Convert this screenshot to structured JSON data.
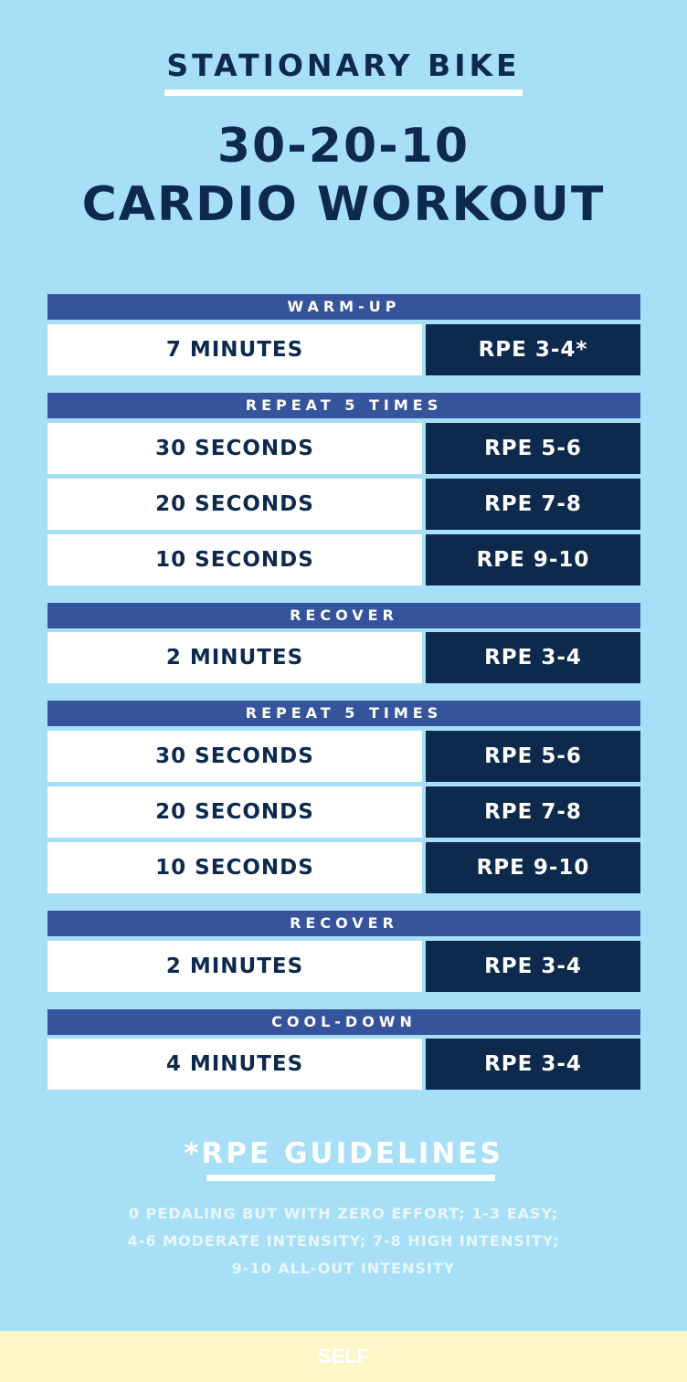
{
  "kicker": "STATIONARY BIKE",
  "title": {
    "line1": "30-20-10",
    "line2": "CARDIO WORKOUT"
  },
  "sections": [
    {
      "header": "WARM-UP",
      "rows": [
        {
          "duration": "7 MINUTES",
          "rpe": "RPE 3-4*"
        }
      ]
    },
    {
      "header": "REPEAT 5 TIMES",
      "rows": [
        {
          "duration": "30 SECONDS",
          "rpe": "RPE 5-6"
        },
        {
          "duration": "20 SECONDS",
          "rpe": "RPE 7-8"
        },
        {
          "duration": "10 SECONDS",
          "rpe": "RPE 9-10"
        }
      ]
    },
    {
      "header": "RECOVER",
      "rows": [
        {
          "duration": "2 MINUTES",
          "rpe": "RPE 3-4"
        }
      ]
    },
    {
      "header": "REPEAT 5 TIMES",
      "rows": [
        {
          "duration": "30 SECONDS",
          "rpe": "RPE 5-6"
        },
        {
          "duration": "20 SECONDS",
          "rpe": "RPE 7-8"
        },
        {
          "duration": "10 SECONDS",
          "rpe": "RPE 9-10"
        }
      ]
    },
    {
      "header": "RECOVER",
      "rows": [
        {
          "duration": "2 MINUTES",
          "rpe": "RPE 3-4"
        }
      ]
    },
    {
      "header": "COOL-DOWN",
      "rows": [
        {
          "duration": "4 MINUTES",
          "rpe": "RPE 3-4"
        }
      ]
    }
  ],
  "guidelines": {
    "title": "*RPE GUIDELINES",
    "lines": [
      "0 PEDALING BUT WITH ZERO EFFORT; 1-3 EASY;",
      "4-6 MODERATE INTENSITY; 7-8 HIGH INTENSITY;",
      "9-10 ALL-OUT INTENSITY"
    ]
  },
  "footer": {
    "logo": "SELF"
  },
  "colors": {
    "background": "#a7dff7",
    "navy": "#0d2a4d",
    "section_header": "#35549c",
    "footer": "#fdf6c8"
  }
}
